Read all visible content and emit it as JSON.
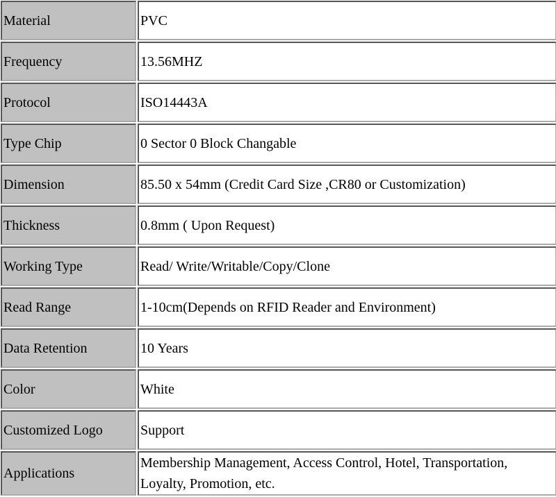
{
  "spec_table": {
    "rows": [
      {
        "label": "Material",
        "value": "PVC"
      },
      {
        "label": "Frequency",
        "value": "13.56MHZ"
      },
      {
        "label": "Protocol",
        "value": "ISO14443A"
      },
      {
        "label": "Type Chip",
        "value": "0 Sector 0 Block Changable"
      },
      {
        "label": "Dimension",
        "value": "85.50 x 54mm (Credit Card Size ,CR80 or Customization)"
      },
      {
        "label": "Thickness",
        "value": "0.8mm ( Upon Request)"
      },
      {
        "label": "Working Type",
        "value": "Read/ Write/Writable/Copy/Clone"
      },
      {
        "label": "Read Range",
        "value": "1-10cm(Depends on RFID Reader and Environment)"
      },
      {
        "label": "Data Retention",
        "value": "10 Years"
      },
      {
        "label": "Color",
        "value": "White"
      },
      {
        "label": "Customized Logo",
        "value": "Support"
      },
      {
        "label": "Applications",
        "value": "Membership Management, Access Control, Hotel, Transportation, Loyalty, Promotion, etc."
      }
    ]
  },
  "colors": {
    "label_bg": "#c0c0c0",
    "value_bg": "#ffffff"
  }
}
